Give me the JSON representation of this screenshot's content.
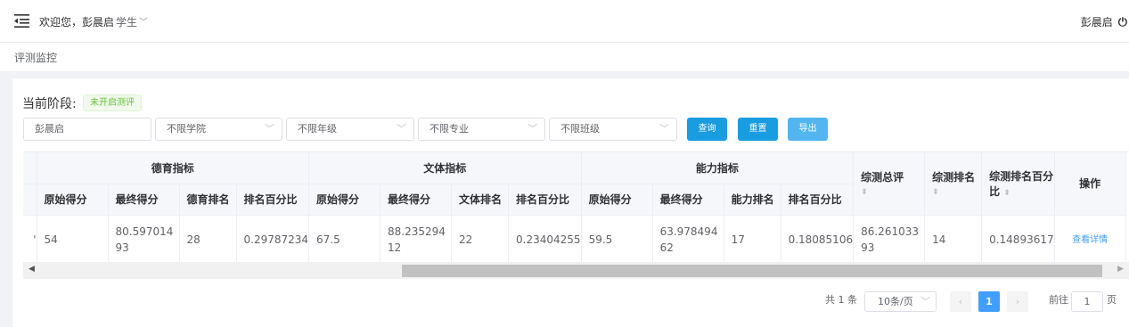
{
  "header": {
    "greeting": "欢迎您，彭晨启",
    "role": "学生",
    "user_name": "彭晨启",
    "icons": {
      "menu": "menu-fold-icon",
      "dropdown": "chevron-down-icon",
      "power": "power-icon"
    }
  },
  "breadcrumb": {
    "current": "评测监控"
  },
  "stage": {
    "label": "当前阶段:",
    "status": "未开启测评"
  },
  "filters": {
    "name_value": "彭晨启",
    "college": "不限学院",
    "grade": "不限年级",
    "major": "不限专业",
    "class": "不限班级"
  },
  "buttons": {
    "query": "查询",
    "reset": "重置",
    "export": "导出"
  },
  "colors": {
    "primary": "#409eff",
    "success": "#67c23a",
    "export": "#53b6f0"
  },
  "table": {
    "groups": [
      "德育指标",
      "文体指标",
      "能力指标"
    ],
    "subheaders": [
      "原始得分",
      "最终得分",
      "德育排名",
      "排名百分比",
      "原始得分",
      "最终得分",
      "文体排名",
      "排名百分比",
      "原始得分",
      "最终得分",
      "能力排名",
      "排名百分比"
    ],
    "total_col": "综测总评",
    "rank_col": "综测排名",
    "pct_col": "综测排名百分比",
    "action_col": "操作",
    "row_marker": "'",
    "row": [
      "54",
      "80.59701493",
      "28",
      "0.29787234",
      "67.5",
      "88.23529412",
      "22",
      "0.23404255",
      "59.5",
      "63.97849462",
      "17",
      "0.18085106",
      "86.26103393",
      "14",
      "0.14893617"
    ],
    "action_link": "查看详情"
  },
  "pagination": {
    "total": "共 1 条",
    "page_size": "10条/页",
    "current_page": "1",
    "goto_label": "前往",
    "goto_value": "1",
    "page_suffix": "页"
  }
}
